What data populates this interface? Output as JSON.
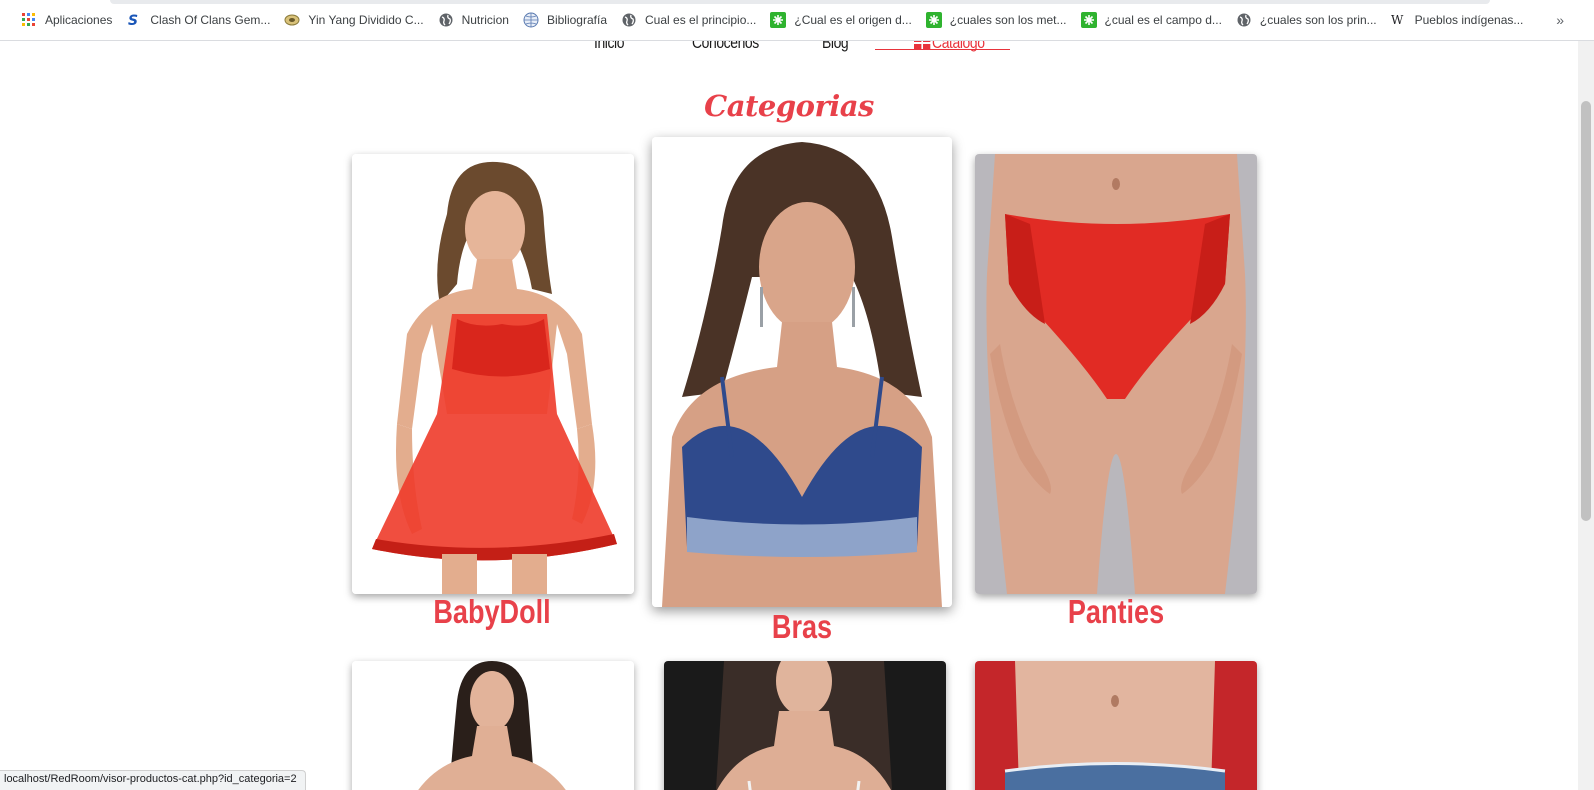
{
  "bookmarks": [
    {
      "label": "Aplicaciones",
      "icon": "apps-grid-icon"
    },
    {
      "label": "Clash Of Clans Gem...",
      "icon": "s-logo-icon"
    },
    {
      "label": "Yin Yang Dividido C...",
      "icon": "yin-yang-icon"
    },
    {
      "label": "Nutricion",
      "icon": "globe-icon"
    },
    {
      "label": "Bibliografía",
      "icon": "globe-blue-icon"
    },
    {
      "label": "Cual es el principio...",
      "icon": "globe-icon"
    },
    {
      "label": "¿Cual es el origen d...",
      "icon": "green-star-icon"
    },
    {
      "label": "¿cuales son los met...",
      "icon": "green-star-icon"
    },
    {
      "label": "¿cual es el campo d...",
      "icon": "green-star-icon"
    },
    {
      "label": "¿cuales son los prin...",
      "icon": "globe-icon"
    },
    {
      "label": "Pueblos indígenas...",
      "icon": "wikipedia-icon"
    }
  ],
  "bookmarks_more": "»",
  "nav": {
    "inicio": "Inicio",
    "conocenos": "Conocenos",
    "blog": "Blog",
    "catalogo": "Catalogo"
  },
  "title": "Categorias",
  "categories": [
    {
      "label": "BabyDoll"
    },
    {
      "label": "Bras"
    },
    {
      "label": "Panties"
    }
  ],
  "status_url": "localhost/RedRoom/visor-productos-cat.php?id_categoria=2",
  "colors": {
    "accent": "#e8414a",
    "nav_active": "#e8333b"
  }
}
